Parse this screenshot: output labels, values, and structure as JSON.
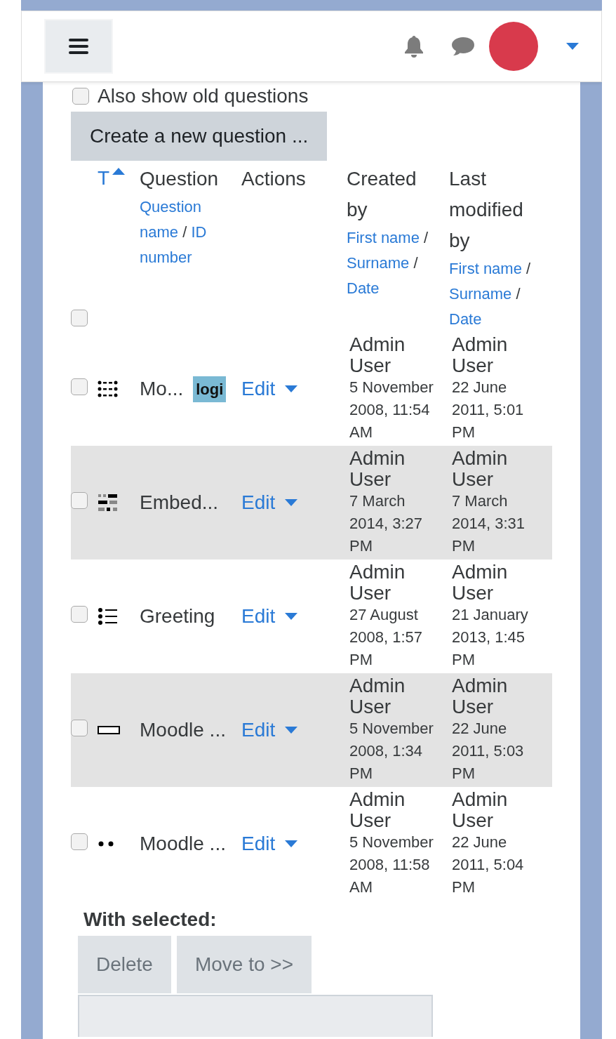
{
  "options": {
    "show_old_questions": {
      "label": "Also show old questions",
      "checked": false
    }
  },
  "create_button": "Create a new question ...",
  "table": {
    "header": {
      "select_all_checked": false,
      "type_sort": {
        "label": "T",
        "ascending": true
      },
      "columns": [
        {
          "title": "Question",
          "links": [
            "Question name",
            "ID number"
          ],
          "separator": "/"
        },
        {
          "title": "Actions"
        },
        {
          "title": "Created by",
          "links": [
            "First name",
            "Surname",
            "Date"
          ],
          "separator": "/"
        },
        {
          "title": "Last modified by",
          "links": [
            "First name",
            "Surname",
            "Date"
          ],
          "separator": "/"
        }
      ]
    },
    "rows": [
      {
        "checked": false,
        "kind": "multichoice",
        "name": "Mo...",
        "tag": "logi",
        "action": "Edit",
        "created_by": "Admin User",
        "created": "5 November 2008, 11:54 AM",
        "modified_by": "Admin User",
        "modified": "22 June 2011, 5:01 PM"
      },
      {
        "checked": false,
        "kind": "embedded",
        "name": "Embed...",
        "action": "Edit",
        "created_by": "Admin User",
        "created": "7 March 2014, 3:27 PM",
        "modified_by": "Admin User",
        "modified": "7 March 2014, 3:31 PM"
      },
      {
        "checked": false,
        "kind": "list",
        "name": "Greeting",
        "action": "Edit",
        "created_by": "Admin User",
        "created": "27 August 2008, 1:57 PM",
        "modified_by": "Admin User",
        "modified": "21 January 2013, 1:45 PM"
      },
      {
        "checked": false,
        "kind": "shortanswer",
        "name": "Moodle ...",
        "action": "Edit",
        "created_by": "Admin User",
        "created": "5 November 2008, 1:34 PM",
        "modified_by": "Admin User",
        "modified": "22 June 2011, 5:03 PM"
      },
      {
        "checked": false,
        "kind": "dots",
        "name": "Moodle ...",
        "action": "Edit",
        "created_by": "Admin User",
        "created": "5 November 2008, 11:58 AM",
        "modified_by": "Admin User",
        "modified": "22 June 2011, 5:04 PM"
      }
    ]
  },
  "with_selected": {
    "label": "With selected:",
    "buttons": [
      {
        "label": "Delete",
        "disabled": true
      },
      {
        "label": "Move to >>",
        "disabled": true
      }
    ]
  }
}
